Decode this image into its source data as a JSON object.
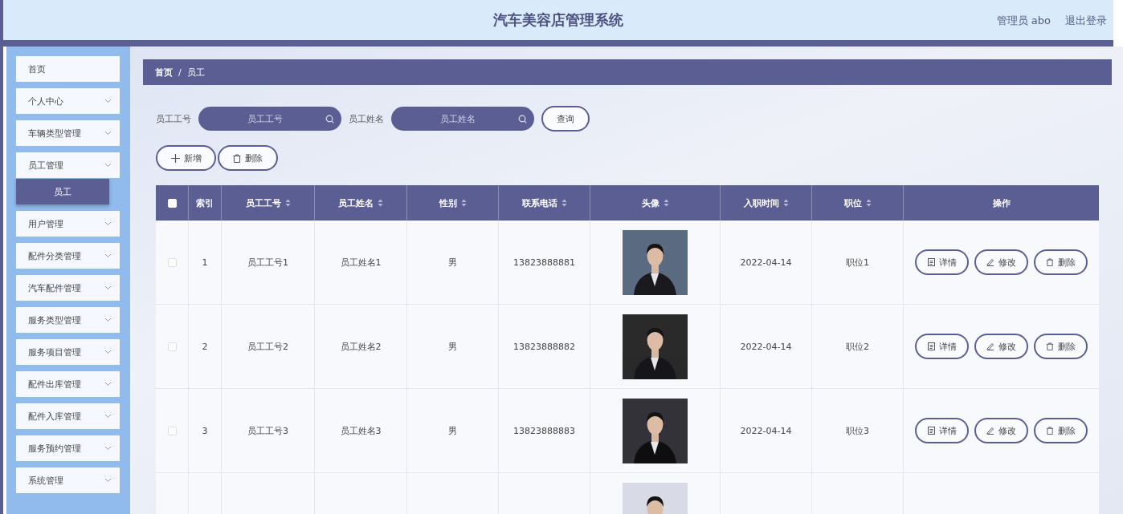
{
  "header": {
    "title": "汽车美容店管理系统",
    "user": "管理员 abo",
    "logout": "退出登录"
  },
  "sidebar": {
    "items": [
      {
        "label": "首页",
        "expandable": false,
        "selected": false
      },
      {
        "label": "个人中心",
        "expandable": true,
        "selected": false
      },
      {
        "label": "车辆类型管理",
        "expandable": true,
        "selected": false
      },
      {
        "label": "员工管理",
        "expandable": true,
        "selected": false,
        "children": [
          {
            "label": "员工",
            "selected": true
          }
        ]
      },
      {
        "label": "用户管理",
        "expandable": true,
        "selected": false
      },
      {
        "label": "配件分类管理",
        "expandable": true,
        "selected": false
      },
      {
        "label": "汽车配件管理",
        "expandable": true,
        "selected": false
      },
      {
        "label": "服务类型管理",
        "expandable": true,
        "selected": false
      },
      {
        "label": "服务项目管理",
        "expandable": true,
        "selected": false
      },
      {
        "label": "配件出库管理",
        "expandable": true,
        "selected": false
      },
      {
        "label": "配件入库管理",
        "expandable": true,
        "selected": false
      },
      {
        "label": "服务预约管理",
        "expandable": true,
        "selected": false
      },
      {
        "label": "系统管理",
        "expandable": true,
        "selected": false
      }
    ]
  },
  "breadcrumb": {
    "separator": "/",
    "items": [
      "首页",
      "员工"
    ]
  },
  "search": {
    "fields": [
      {
        "label": "员工工号",
        "placeholder": "员工工号"
      },
      {
        "label": "员工姓名",
        "placeholder": "员工姓名"
      }
    ],
    "button": "查询"
  },
  "actions": [
    {
      "kind": "add",
      "label": "新增"
    },
    {
      "kind": "delete",
      "label": "删除"
    }
  ],
  "table": {
    "select_all": {
      "checked": false
    },
    "columns": [
      {
        "label": "索引",
        "sortable": false
      },
      {
        "label": "员工工号",
        "sortable": true
      },
      {
        "label": "员工姓名",
        "sortable": true
      },
      {
        "label": "性别",
        "sortable": true
      },
      {
        "label": "联系电话",
        "sortable": true
      },
      {
        "label": "头像",
        "sortable": true
      },
      {
        "label": "入职时间",
        "sortable": true
      },
      {
        "label": "职位",
        "sortable": true
      },
      {
        "label": "操作",
        "sortable": false
      }
    ],
    "rows": [
      {
        "checked": false,
        "index": "1",
        "id": "员工工号1",
        "name": "员工姓名1",
        "gender": "男",
        "phone": "13823888881",
        "avatar": {
          "kind": "picture"
        },
        "date": "2022-04-14",
        "position": "职位1",
        "buttons": [
          {
            "kind": "detail",
            "label": "详情"
          },
          {
            "kind": "edit",
            "label": "修改"
          },
          {
            "kind": "delete",
            "label": "删除"
          }
        ]
      },
      {
        "checked": false,
        "index": "2",
        "id": "员工工号2",
        "name": "员工姓名2",
        "gender": "男",
        "phone": "13823888882",
        "avatar": {
          "kind": "picture"
        },
        "date": "2022-04-14",
        "position": "职位2",
        "buttons": [
          {
            "kind": "detail",
            "label": "详情"
          },
          {
            "kind": "edit",
            "label": "修改"
          },
          {
            "kind": "delete",
            "label": "删除"
          }
        ]
      },
      {
        "checked": false,
        "index": "3",
        "id": "员工工号3",
        "name": "员工姓名3",
        "gender": "男",
        "phone": "13823888883",
        "avatar": {
          "kind": "picture"
        },
        "date": "2022-04-14",
        "position": "职位3",
        "buttons": [
          {
            "kind": "detail",
            "label": "详情"
          },
          {
            "kind": "edit",
            "label": "修改"
          },
          {
            "kind": "delete",
            "label": "删除"
          }
        ]
      },
      {
        "avatar": {
          "kind": "picture"
        }
      }
    ]
  }
}
